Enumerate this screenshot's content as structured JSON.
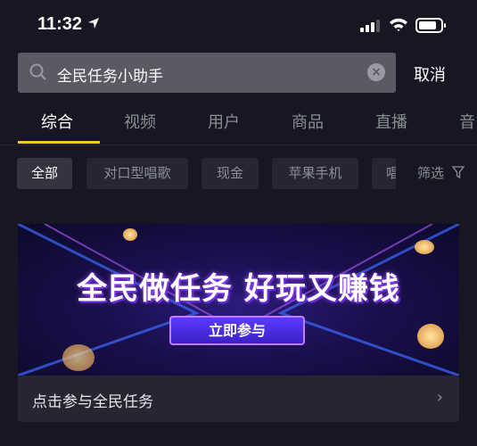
{
  "status": {
    "time": "11:32"
  },
  "search": {
    "value": "全民任务小助手",
    "cancel": "取消"
  },
  "tabs": [
    "综合",
    "视频",
    "用户",
    "商品",
    "直播",
    "音"
  ],
  "chips": [
    "全部",
    "对口型唱歌",
    "现金",
    "苹果手机",
    "唱歌"
  ],
  "filter": "筛选",
  "banner": {
    "title": "全民做任务 好玩又赚钱",
    "button": "立即参与",
    "footer": "点击参与全民任务"
  },
  "colors": {
    "background": "#161722",
    "accent": "#f7c72e",
    "chip": "#252632"
  }
}
